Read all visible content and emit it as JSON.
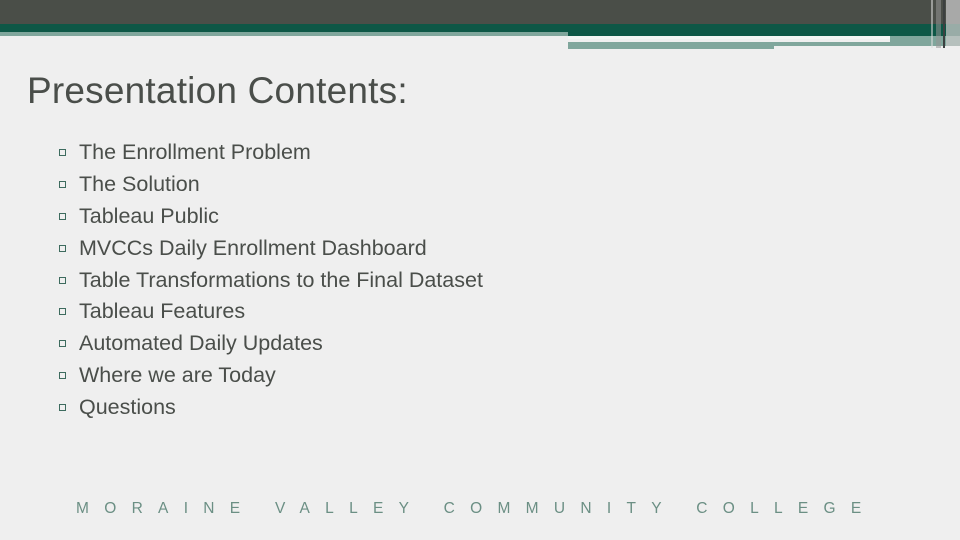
{
  "slide": {
    "title": "Presentation Contents:",
    "bullets": [
      "The Enrollment Problem",
      "The Solution",
      "Tableau Public",
      "MVCCs Daily Enrollment Dashboard",
      "Table Transformations to the Final Dataset",
      "Tableau Features",
      "Automated Daily Updates",
      "Where we are Today",
      "Questions"
    ],
    "footer": "MORAINE VALLEY COMMUNITY COLLEGE"
  },
  "colors": {
    "header_dark": "#4a4e48",
    "header_green": "#0e5746",
    "accent_teal": "#80a69c",
    "text": "#4a4e4a",
    "footer_text": "#6b8f84",
    "background": "#efefef"
  }
}
